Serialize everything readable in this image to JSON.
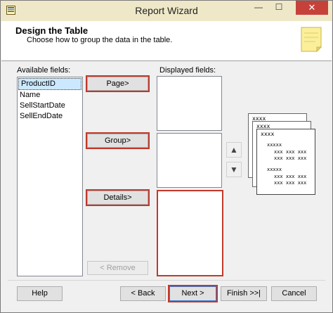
{
  "window": {
    "title": "Report Wizard",
    "minimize": "—",
    "maximize": "☐",
    "close": "✕"
  },
  "header": {
    "title": "Design the Table",
    "subtitle": "Choose how to group the data in the table."
  },
  "available": {
    "label": "Available fields:",
    "items": [
      "ProductID",
      "Name",
      "SellStartDate",
      "SellEndDate"
    ],
    "selected": 0
  },
  "displayed": {
    "label": "Displayed fields:"
  },
  "buttons": {
    "page": "Page>",
    "group": "Group>",
    "details": "Details>",
    "remove": "< Remove"
  },
  "arrows": {
    "up": "▲",
    "down": "▼"
  },
  "preview": {
    "card1": "xxxx",
    "card2": "xxxx",
    "card3": "xxxx",
    "group_a": "xxxxx",
    "row_a1": "xxx xxx xxx",
    "row_a2": "xxx xxx xxx",
    "group_b": "xxxxx",
    "row_b1": "xxx xxx xxx",
    "row_b2": "xxx xxx xxx"
  },
  "footer": {
    "help": "Help",
    "back": "< Back",
    "next": "Next >",
    "finish": "Finish >>|",
    "cancel": "Cancel"
  },
  "colors": {
    "accent_frame": "#c0392b",
    "selection": "#cce8ff",
    "close_button": "#c7413b"
  }
}
